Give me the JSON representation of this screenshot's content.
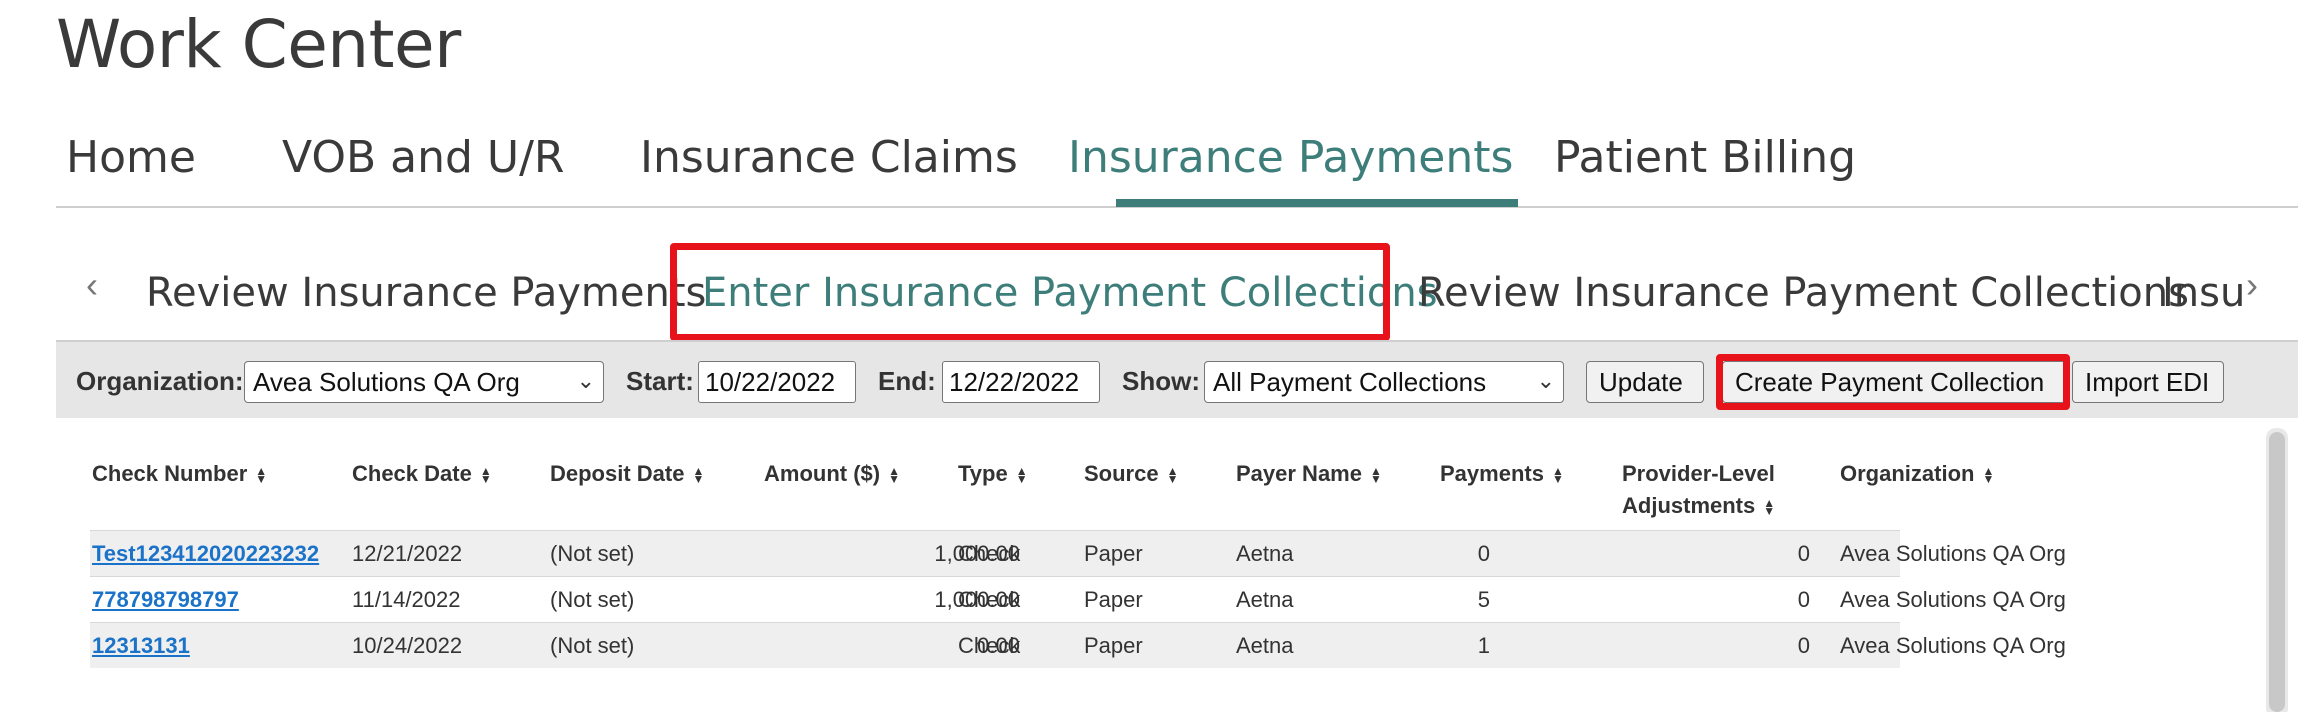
{
  "page": {
    "title": "Work Center"
  },
  "main_nav": {
    "tabs": [
      {
        "label": "Home"
      },
      {
        "label": "VOB and U/R"
      },
      {
        "label": "Insurance Claims"
      },
      {
        "label": "Insurance Payments",
        "active": true
      },
      {
        "label": "Patient Billing"
      }
    ]
  },
  "sub_nav": {
    "prev_icon": "chevron-left-icon",
    "next_icon": "chevron-right-icon",
    "tabs": [
      {
        "label": "Review Insurance Payments"
      },
      {
        "label": "Enter Insurance Payment Collections",
        "active": true
      },
      {
        "label": "Review Insurance Payment Collections"
      },
      {
        "label": "Insu"
      }
    ]
  },
  "toolbar": {
    "organization_label": "Organization:",
    "organization_value": "Avea Solutions QA Org",
    "start_label": "Start:",
    "start_value": "10/22/2022",
    "end_label": "End:",
    "end_value": "12/22/2022",
    "show_label": "Show:",
    "show_value": "All Payment Collections",
    "update_label": "Update",
    "create_label": "Create Payment Collection",
    "import_label": "Import EDI"
  },
  "table": {
    "columns": [
      {
        "label": "Check Number"
      },
      {
        "label": "Check Date"
      },
      {
        "label": "Deposit Date"
      },
      {
        "label": "Amount ($)"
      },
      {
        "label": "Type"
      },
      {
        "label": "Source"
      },
      {
        "label": "Payer Name"
      },
      {
        "label": "Payments"
      },
      {
        "label": "Provider-Level",
        "label2": "Adjustments"
      },
      {
        "label": "Organization"
      }
    ],
    "rows": [
      {
        "check_number": "Test123412020223232",
        "check_date": "12/21/2022",
        "deposit_date": "(Not set)",
        "amount": "1,000.00",
        "type": "Check",
        "source": "Paper",
        "payer": "Aetna",
        "payments": "0",
        "adjustments": "0",
        "organization": "Avea Solutions QA Org"
      },
      {
        "check_number": "778798798797",
        "check_date": "11/14/2022",
        "deposit_date": "(Not set)",
        "amount": "1,000.00",
        "type": "Check",
        "source": "Paper",
        "payer": "Aetna",
        "payments": "5",
        "adjustments": "0",
        "organization": "Avea Solutions QA Org"
      },
      {
        "check_number": "12313131",
        "check_date": "10/24/2022",
        "deposit_date": "(Not set)",
        "amount": "0.00",
        "type": "Check",
        "source": "Paper",
        "payer": "Aetna",
        "payments": "1",
        "adjustments": "0",
        "organization": "Avea Solutions QA Org"
      }
    ]
  },
  "colors": {
    "accent": "#3e7e7a",
    "highlight": "#e8131a",
    "link": "#1a73c9"
  }
}
